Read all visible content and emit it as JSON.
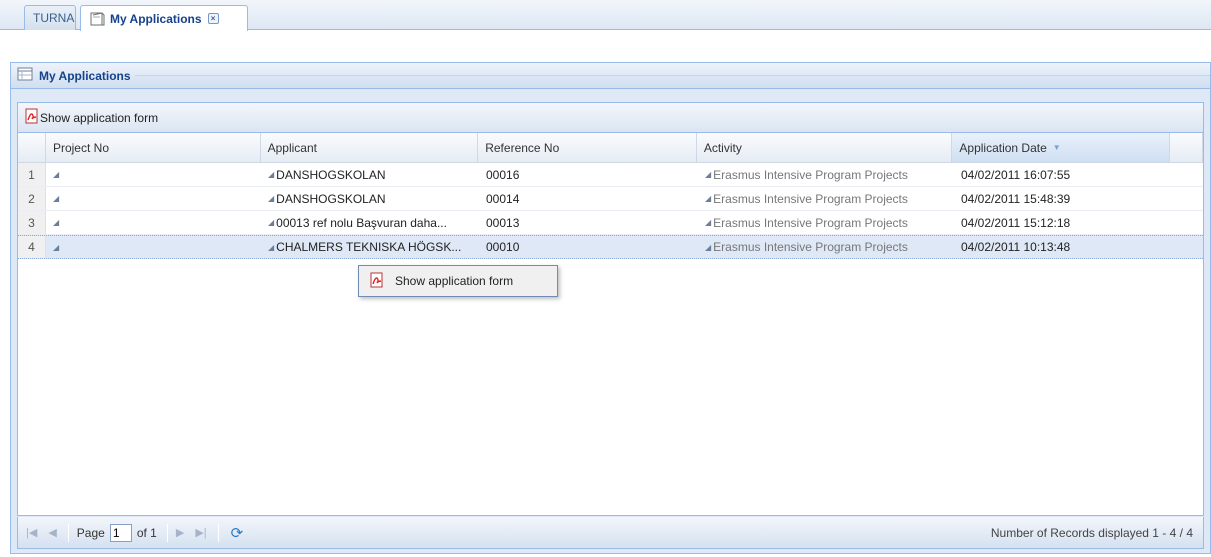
{
  "tabs": [
    {
      "label": "TURNA"
    },
    {
      "label": "My Applications"
    }
  ],
  "panel": {
    "title": "My Applications"
  },
  "toolbar": {
    "show_form_label": "Show application form"
  },
  "grid": {
    "columns": [
      "Project No",
      "Applicant",
      "Reference No",
      "Activity",
      "Application Date"
    ],
    "rows": [
      {
        "num": "1",
        "project": "",
        "applicant": "DANSHOGSKOLAN",
        "reference": "00016",
        "activity": "Erasmus Intensive Program Projects",
        "date": "04/02/2011 16:07:55"
      },
      {
        "num": "2",
        "project": "",
        "applicant": "DANSHOGSKOLAN",
        "reference": "00014",
        "activity": "Erasmus Intensive Program Projects",
        "date": "04/02/2011 15:48:39"
      },
      {
        "num": "3",
        "project": "",
        "applicant": "00013 ref nolu Başvuran daha...",
        "reference": "00013",
        "activity": "Erasmus Intensive Program Projects",
        "date": "04/02/2011 15:12:18"
      },
      {
        "num": "4",
        "project": "",
        "applicant": "CHALMERS TEKNISKA HÖGSK...",
        "reference": "00010",
        "activity": "Erasmus Intensive Program Projects",
        "date": "04/02/2011 10:13:48"
      }
    ]
  },
  "context_menu": {
    "item_label": "Show application form"
  },
  "pager": {
    "page_label": "Page",
    "page_value": "1",
    "of_label": "of 1",
    "info": "Number of Records displayed 1 - 4 / 4"
  },
  "colors": {
    "accent": "#15428b",
    "border": "#99bbe8",
    "selected_row": "#dfe8f6"
  }
}
